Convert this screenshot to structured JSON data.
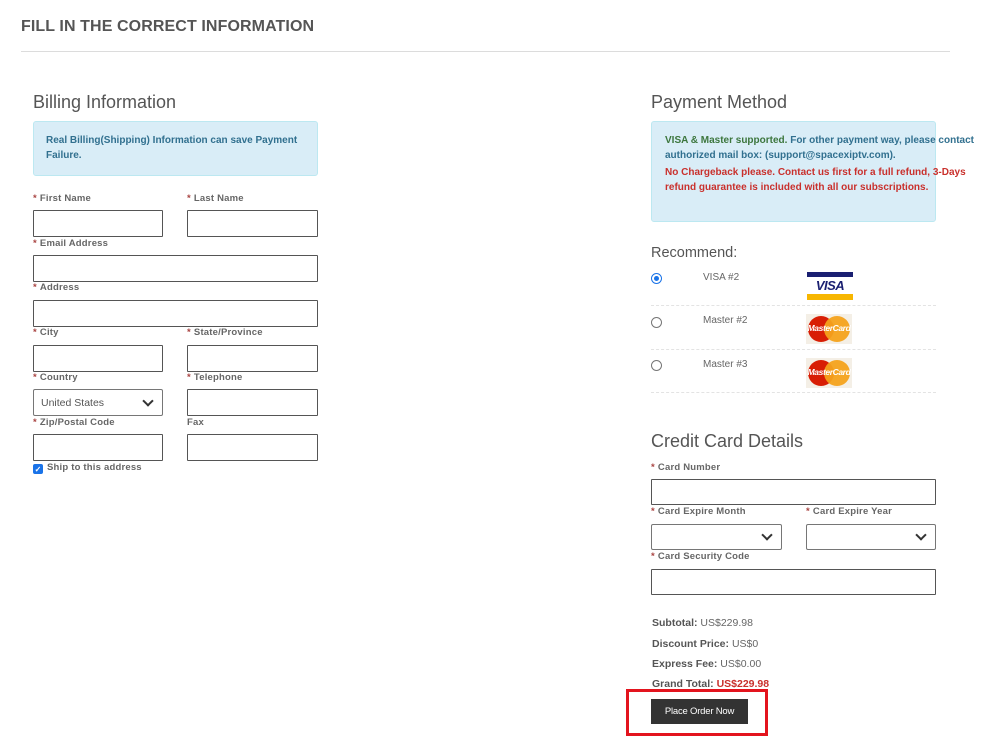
{
  "page": {
    "title": "FILL IN THE CORRECT INFORMATION"
  },
  "billing": {
    "title": "Billing Information",
    "notice": "Real Billing(Shipping) Information can save Payment Failure.",
    "required_marker": "*",
    "fields": {
      "first_name": {
        "label": "First Name",
        "value": ""
      },
      "last_name": {
        "label": "Last Name",
        "value": ""
      },
      "email": {
        "label": "Email Address",
        "value": ""
      },
      "address": {
        "label": "Address",
        "value": ""
      },
      "city": {
        "label": "City",
        "value": ""
      },
      "state": {
        "label": "State/Province",
        "value": ""
      },
      "country": {
        "label": "Country",
        "value": "United States"
      },
      "telephone": {
        "label": "Telephone",
        "value": ""
      },
      "zip": {
        "label": "Zip/Postal Code",
        "value": ""
      },
      "fax": {
        "label": "Fax",
        "value": ""
      }
    },
    "ship_to_address": {
      "label": "Ship to this address",
      "checked": true
    }
  },
  "payment": {
    "title": "Payment Method",
    "notice_supported": "VISA & Master supported.",
    "notice_contact": " For other payment way, please contact authorized mail box: (support@spacexiptv.com).",
    "notice_warning": "No Chargeback please. Contact us first for a full refund, 3-Days refund guarantee is included with all our subscriptions.",
    "recommend_label": "Recommend:",
    "methods": [
      {
        "label": "VISA #2",
        "logo": "VISA",
        "icon": "visa-icon",
        "selected": true
      },
      {
        "label": "Master #2",
        "logo": "MasterCard",
        "icon": "mastercard-icon",
        "selected": false
      },
      {
        "label": "Master #3",
        "logo": "MasterCard",
        "icon": "mastercard-icon",
        "selected": false
      }
    ]
  },
  "credit_card": {
    "title": "Credit Card Details",
    "fields": {
      "card_number": {
        "label": "Card Number",
        "value": ""
      },
      "expire_month": {
        "label": "Card Expire Month",
        "value": ""
      },
      "expire_year": {
        "label": "Card Expire Year",
        "value": ""
      },
      "security_code": {
        "label": "Card Security Code",
        "value": ""
      }
    }
  },
  "summary": {
    "subtotal_label": "Subtotal:",
    "subtotal_value": "US$229.98",
    "discount_label": "Discount Price:",
    "discount_value": "US$0",
    "express_label": "Express Fee:",
    "express_value": "US$0.00",
    "grand_label": "Grand Total:",
    "grand_value": "US$229.98",
    "grand_color": "#c9302c"
  },
  "actions": {
    "place_order_label": "Place Order Now"
  }
}
